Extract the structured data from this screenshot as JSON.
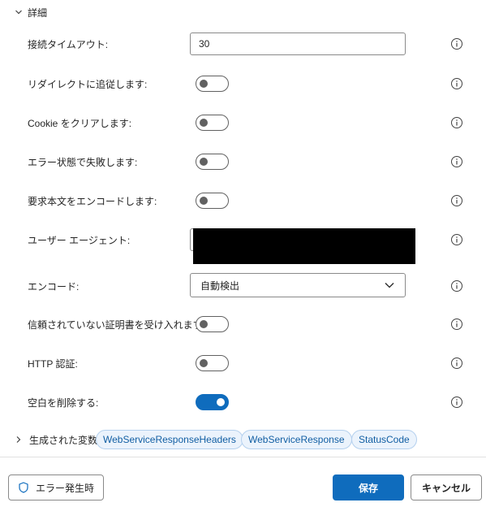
{
  "details": {
    "title": "詳細"
  },
  "fields": {
    "timeout": {
      "label": "接続タイムアウト:",
      "value": "30"
    },
    "redirect": {
      "label": "リダイレクトに追従します:",
      "enabled": false
    },
    "cookie": {
      "label": "Cookie をクリアします:",
      "enabled": false
    },
    "fail_on_error": {
      "label": "エラー状態で失敗します:",
      "enabled": false
    },
    "encode_body": {
      "label": "要求本文をエンコードします:",
      "enabled": false
    },
    "user_agent": {
      "label": "ユーザー エージェント:",
      "value": ""
    },
    "encoding": {
      "label": "エンコード:",
      "value": "自動検出"
    },
    "untrusted_cert": {
      "label": "信頼されていない証明書を受け入れます:",
      "enabled": false
    },
    "http_auth": {
      "label": "HTTP 認証:",
      "enabled": false
    },
    "trim_whitespace": {
      "label": "空白を削除する:",
      "enabled": true
    }
  },
  "generated_vars": {
    "title": "生成された変数",
    "chips": [
      "WebServiceResponseHeaders",
      "WebServiceResponse",
      "StatusCode"
    ]
  },
  "footer": {
    "error_button": "エラー発生時",
    "save_button": "保存",
    "cancel_button": "キャンセル"
  },
  "colors": {
    "accent": "#0f6cbd",
    "chip_bg": "#ebf3fc",
    "chip_text": "#115ea3"
  }
}
